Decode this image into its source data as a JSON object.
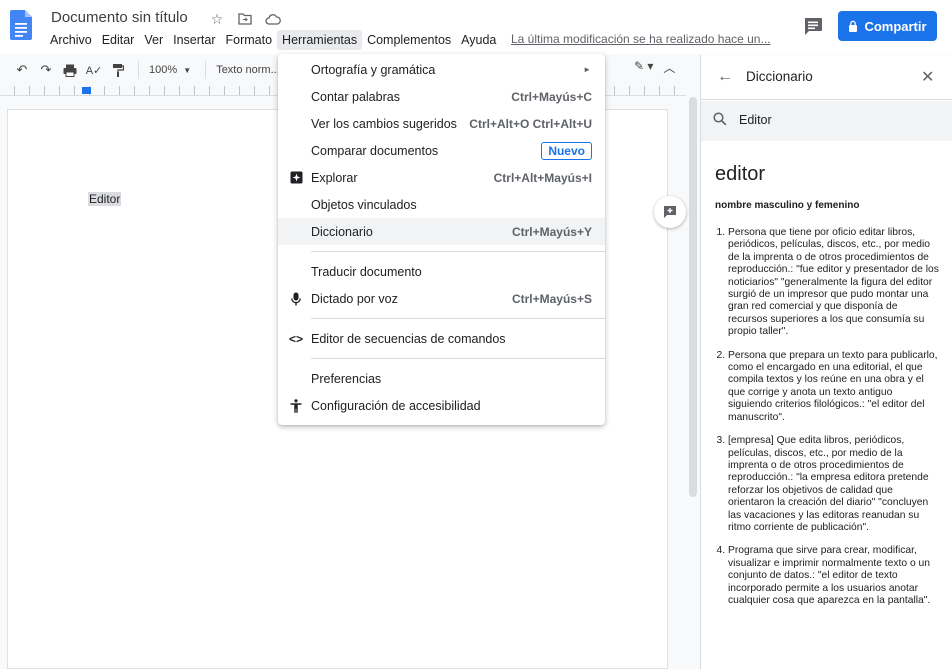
{
  "header": {
    "doc_title": "Documento sin título",
    "menus": [
      "Archivo",
      "Editar",
      "Ver",
      "Insertar",
      "Formato",
      "Herramientas",
      "Complementos",
      "Ayuda"
    ],
    "last_edit": "La última modificación se ha realizado hace un...",
    "share_label": "Compartir"
  },
  "toolbar": {
    "zoom": "100%",
    "style": "Texto norm..."
  },
  "document": {
    "text": "Editor"
  },
  "tools_menu": {
    "items": [
      {
        "label": "Ortografía y gramática",
        "submenu": true
      },
      {
        "label": "Contar palabras",
        "shortcut": "Ctrl+Mayús+C"
      },
      {
        "label": "Ver los cambios sugeridos",
        "shortcut": "Ctrl+Alt+O Ctrl+Alt+U"
      },
      {
        "label": "Comparar documentos",
        "badge": "Nuevo"
      },
      {
        "label": "Explorar",
        "shortcut": "Ctrl+Alt+Mayús+I",
        "icon": "explore-icon"
      },
      {
        "label": "Objetos vinculados"
      },
      {
        "label": "Diccionario",
        "shortcut": "Ctrl+Mayús+Y",
        "highlighted": true
      },
      {
        "label": "Traducir documento"
      },
      {
        "label": "Dictado por voz",
        "shortcut": "Ctrl+Mayús+S",
        "icon": "microphone-icon"
      },
      {
        "label": "Editor de secuencias de comandos",
        "icon": "code-icon"
      },
      {
        "label": "Preferencias"
      },
      {
        "label": "Configuración de accesibilidad",
        "icon": "accessibility-icon"
      }
    ]
  },
  "dictionary": {
    "title": "Diccionario",
    "search_value": "Editor",
    "word": "editor",
    "part_of_speech": "nombre masculino y femenino",
    "definitions": [
      "Persona que tiene por oficio editar libros, periódicos, películas, discos, etc., por medio de la imprenta o de otros procedimientos de reproducción.: \"fue editor y presentador de los noticiarios\" \"generalmente la figura del editor surgió de un impresor que pudo montar una gran red comercial y que disponía de recursos superiores a los que consumía su propio taller\".",
      "Persona que prepara un texto para publicarlo, como el encargado en una editorial, el que compila textos y los reúne en una obra y el que corrige y anota un texto antiguo siguiendo criterios filológicos.: \"el editor del manuscrito\".",
      "[empresa] Que edita libros, periódicos, películas, discos, etc., por medio de la imprenta o de otros procedimientos de reproducción.: \"la empresa editora pretende reforzar los objetivos de calidad que orientaron la creación del diario\" \"concluyen las vacaciones y las editoras reanudan su ritmo corriente de publicación\".",
      "Programa que sirve para crear, modificar, visualizar e imprimir normalmente texto o un conjunto de datos.: \"el editor de texto incorporado permite a los usuarios anotar cualquier cosa que aparezca en la pantalla\"."
    ]
  },
  "colors": {
    "accent": "#1a73e8",
    "menu_highlight": "#f1f3f4"
  }
}
